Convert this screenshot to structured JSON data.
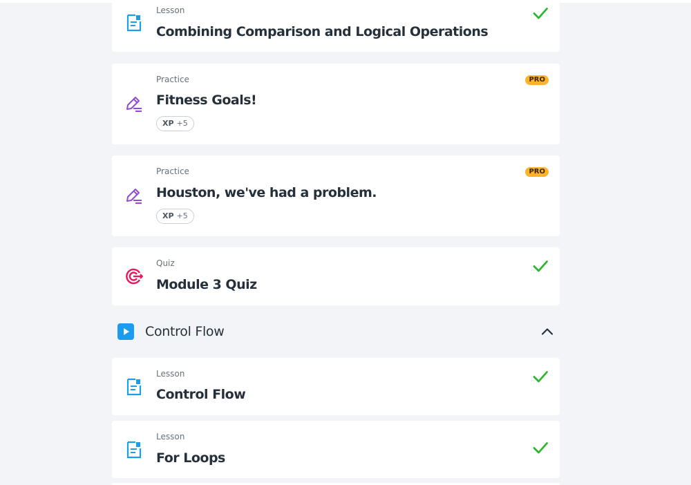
{
  "items_top": [
    {
      "type": "Lesson",
      "title": "Combining Comparison and Logical Operations",
      "completed": true,
      "icon": "lesson-document-icon"
    },
    {
      "type": "Practice",
      "title": "Fitness Goals!",
      "badge": "PRO",
      "xp_label": "XP",
      "xp_value": "+5",
      "icon": "practice-pencil-icon"
    },
    {
      "type": "Practice",
      "title": "Houston, we've had a problem.",
      "badge": "PRO",
      "xp_label": "XP",
      "xp_value": "+5",
      "icon": "practice-pencil-icon"
    },
    {
      "type": "Quiz",
      "title": "Module 3 Quiz",
      "completed": true,
      "icon": "quiz-target-icon"
    }
  ],
  "section": {
    "title": "Control Flow",
    "expanded": true,
    "items": [
      {
        "type": "Lesson",
        "title": "Control Flow",
        "completed": true,
        "icon": "lesson-document-icon"
      },
      {
        "type": "Lesson",
        "title": "For Loops",
        "completed": true,
        "icon": "lesson-document-icon"
      }
    ]
  },
  "colors": {
    "background": "#f2f4f7",
    "check": "#2fb62f",
    "pro_badge": "#ffb22e",
    "lesson_icon": "#1b9cec",
    "practice_icon": "#8f4ad6",
    "quiz_icon": "#e8175d",
    "section_play": "#1b9cec"
  }
}
